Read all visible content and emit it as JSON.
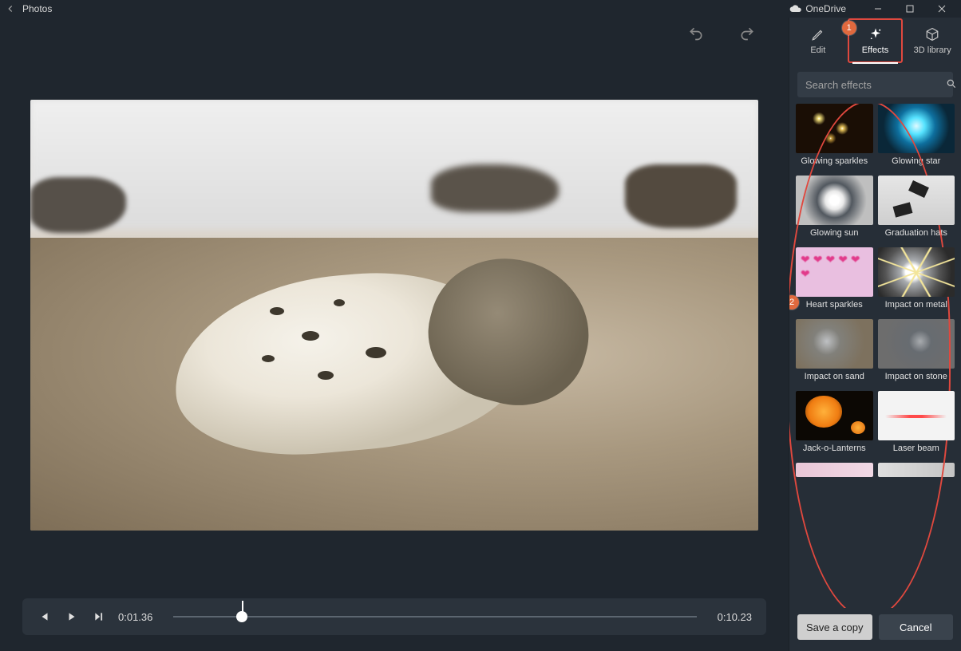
{
  "titlebar": {
    "app_title": "Photos",
    "cloud_label": "OneDrive"
  },
  "undo_redo": {
    "undo": "↶",
    "redo": "↷"
  },
  "playback": {
    "current_time": "0:01.36",
    "total_time": "0:10.23",
    "progress_pct": 13
  },
  "panel": {
    "tabs": {
      "edit": "Edit",
      "effects": "Effects",
      "library": "3D library"
    },
    "search_placeholder": "Search effects",
    "effects": [
      {
        "key": "glowing-sparkles",
        "label": "Glowing sparkles"
      },
      {
        "key": "glowing-star",
        "label": "Glowing star"
      },
      {
        "key": "glowing-sun",
        "label": "Glowing sun"
      },
      {
        "key": "graduation-hats",
        "label": "Graduation hats"
      },
      {
        "key": "heart-sparkles",
        "label": "Heart sparkles"
      },
      {
        "key": "impact-on-metal",
        "label": "Impact on metal"
      },
      {
        "key": "impact-on-sand",
        "label": "Impact on sand"
      },
      {
        "key": "impact-on-stone",
        "label": "Impact on stone"
      },
      {
        "key": "jack-o-lanterns",
        "label": "Jack-o-Lanterns"
      },
      {
        "key": "laser-beam",
        "label": "Laser beam"
      }
    ],
    "save_label": "Save a copy",
    "cancel_label": "Cancel"
  },
  "annotations": {
    "callout1": "1",
    "callout2": "2"
  }
}
